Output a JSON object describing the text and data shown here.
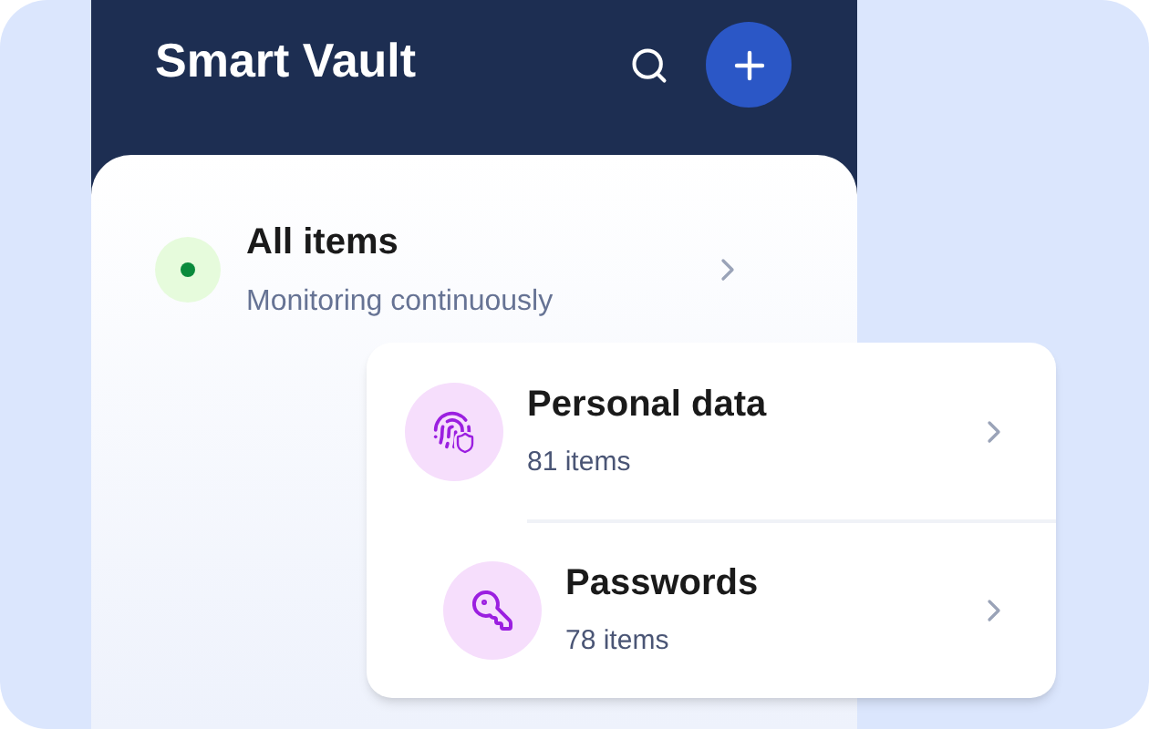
{
  "app": {
    "title": "Smart Vault"
  },
  "summary": {
    "title": "All items",
    "subtitle": "Monitoring continuously",
    "color": "#0a8a3c"
  },
  "categories": [
    {
      "kind": "fingerprint",
      "title": "Personal data",
      "count": "81 items"
    },
    {
      "kind": "key",
      "title": "Passwords",
      "count": "78 items"
    }
  ]
}
